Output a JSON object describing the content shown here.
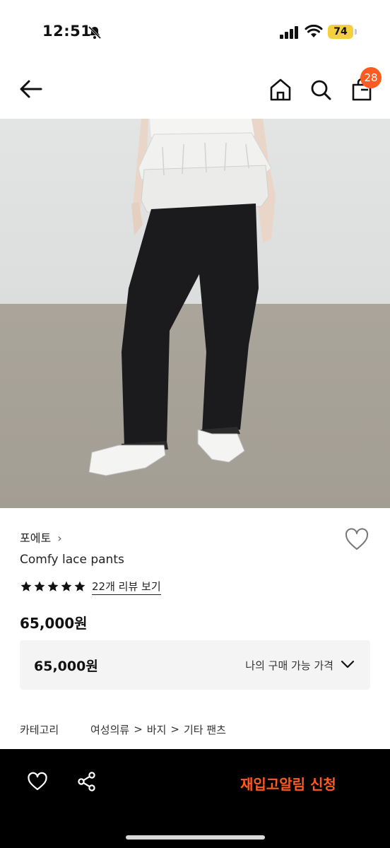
{
  "status": {
    "time": "12:51",
    "battery": "74"
  },
  "nav": {
    "cart_count": "28"
  },
  "product": {
    "brand": "포에토",
    "brand_chevron": "›",
    "name": "Comfy lace pants",
    "rating_stars": 5,
    "review_link": "22개 리뷰 보기",
    "price": "65,000원",
    "box_price": "65,000원",
    "box_label": "나의 구매 가능 가격"
  },
  "category": {
    "label": "카테고리",
    "path": [
      "여성의류",
      "바지",
      "기타 팬츠"
    ],
    "separator": ">"
  },
  "bottom": {
    "restock_label": "재입고알림 신청"
  },
  "colors": {
    "accent": "#ff5a1f",
    "bottom_bar": "#000000",
    "price_box": "#f4f4f4"
  }
}
